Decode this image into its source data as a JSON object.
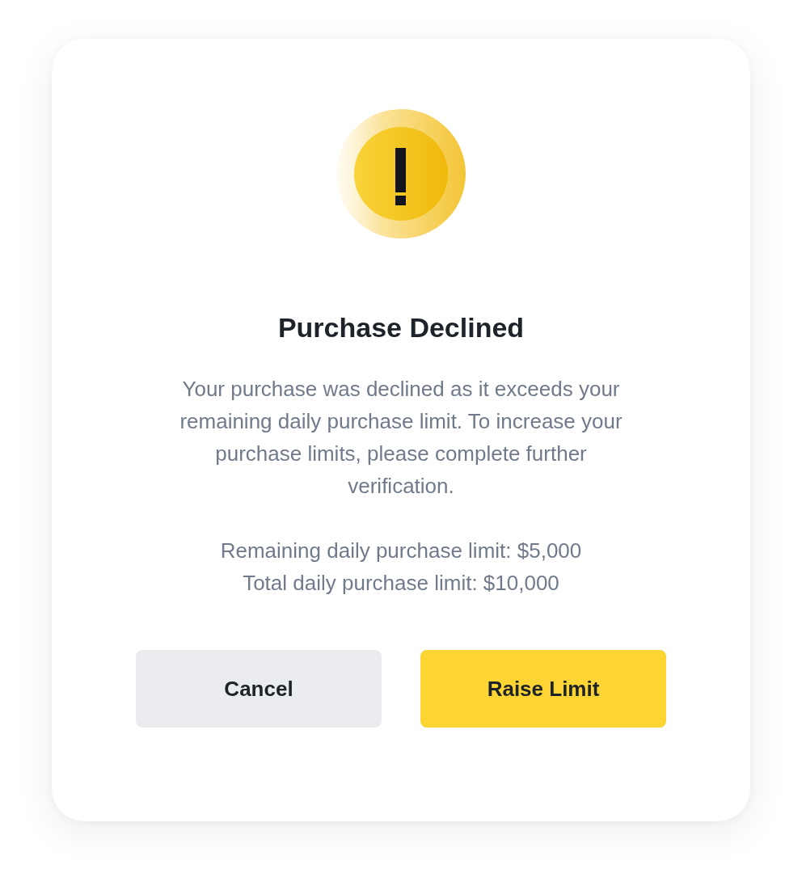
{
  "dialog": {
    "title": "Purchase Declined",
    "message": "Your purchase was declined as it exceeds your remaining daily purchase limit. To increase your purchase limits, please complete further verification.",
    "limits": [
      "Remaining daily purchase limit: $5,000",
      "Total daily purchase limit: $10,000"
    ],
    "buttons": [
      {
        "label": "Cancel",
        "kind": "secondary"
      },
      {
        "label": "Raise Limit",
        "kind": "primary"
      }
    ]
  }
}
